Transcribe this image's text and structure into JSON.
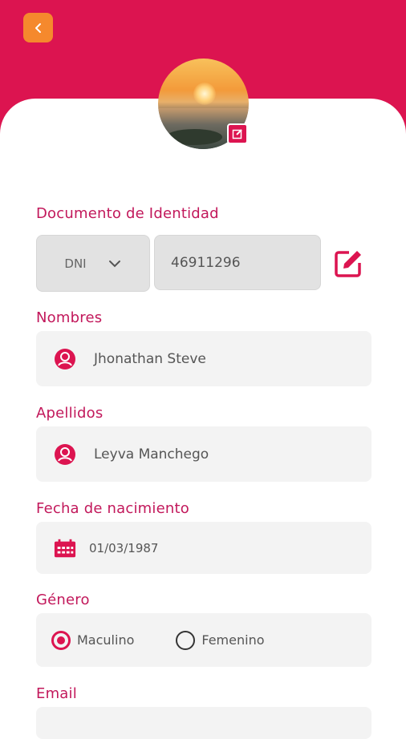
{
  "colors": {
    "brand": "#dc1450",
    "back": "#f5892d",
    "label": "#c2185b",
    "field": "#f3f3f3"
  },
  "header": {
    "back_icon": "chevron-left-icon"
  },
  "profile": {
    "photo": "sunset-beach-photo",
    "edit_icon": "edit-icon"
  },
  "document": {
    "label": "Documento de Identidad",
    "type_value": "DNI",
    "number_value": "46911296",
    "edit_icon": "edit-icon"
  },
  "first_name": {
    "label": "Nombres",
    "value": "Jhonathan Steve",
    "icon": "user-icon"
  },
  "last_name": {
    "label": "Apellidos",
    "value": "Leyva Manchego",
    "icon": "user-icon"
  },
  "birth_date": {
    "label": "Fecha de nacimiento",
    "value": "01/03/1987",
    "icon": "calendar-icon"
  },
  "gender": {
    "label": "Género",
    "options": [
      {
        "label": "Maculino",
        "selected": true
      },
      {
        "label": "Femenino",
        "selected": false
      }
    ]
  },
  "email": {
    "label": "Email"
  }
}
